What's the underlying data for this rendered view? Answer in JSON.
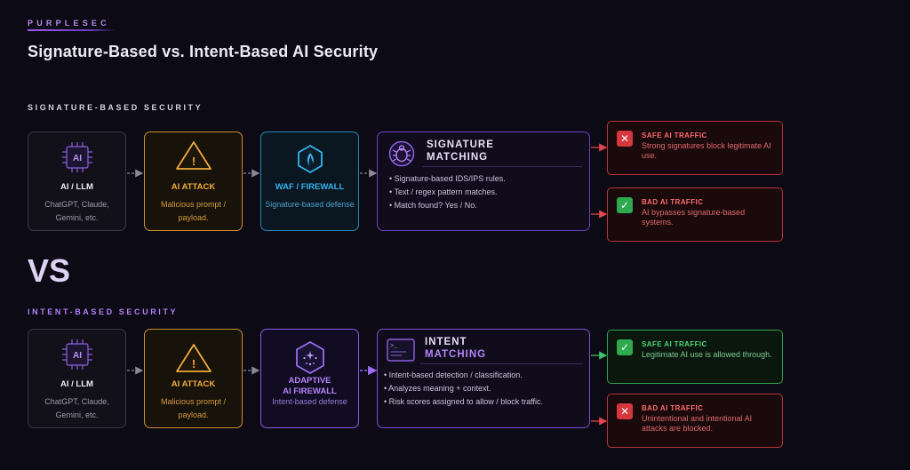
{
  "brand": "PURPLESEC",
  "title": "Signature-Based vs. Intent-Based AI Security",
  "vs_label": "VS",
  "signature_section": {
    "label": "SIGNATURE-BASED SECURITY",
    "ai_card": {
      "icon_text": "AI",
      "title": "AI / LLM",
      "subtitle": "ChatGPT, Claude, Gemini, etc.",
      "icon": "chip-icon"
    },
    "attack_card": {
      "icon_text": "!",
      "title": "AI ATTACK",
      "subtitle": "Malicious prompt / payload.",
      "icon": "warning-triangle-icon"
    },
    "defense_card": {
      "title": "WAF / FIREWALL",
      "subtitle": "Signature-based defense",
      "icon": "shield-hexagon-icon"
    },
    "matching": {
      "title_line1": "SIGNATURE",
      "title_line2": "MATCHING",
      "icon": "bug-icon",
      "bullets": [
        "• Signature-based IDS/IPS rules.",
        "• Text / regex pattern matches.",
        "• Match found? Yes / No."
      ]
    },
    "outcomes": [
      {
        "status": "fail",
        "title": "SAFE AI TRAFFIC",
        "desc": "Strong signatures block legitimate AI use."
      },
      {
        "status": "pass",
        "title": "BAD AI TRAFFIC",
        "desc": "AI bypasses signature-based systems."
      }
    ]
  },
  "intent_section": {
    "label": "INTENT-BASED SECURITY",
    "ai_card": {
      "icon_text": "AI",
      "title": "AI / LLM",
      "subtitle": "ChatGPT, Claude, Gemini, etc.",
      "icon": "chip-icon"
    },
    "attack_card": {
      "icon_text": "!",
      "title": "AI ATTACK",
      "subtitle": "Malicious prompt / payload.",
      "icon": "warning-triangle-icon"
    },
    "defense_card": {
      "title_line1": "ADAPTIVE",
      "title_line2": "AI FIREWALL",
      "subtitle": "Intent-based defense",
      "icon": "sparkle-hexagon-icon"
    },
    "matching": {
      "title_line1": "INTENT",
      "title_line2": "MATCHING",
      "icon": "terminal-icon",
      "bullets": [
        "• Intent-based detection / classification.",
        "• Analyzes meaning + context.",
        "• Risk scores assigned to allow / block traffic."
      ]
    },
    "outcomes": [
      {
        "status": "pass",
        "title": "SAFE AI TRAFFIC",
        "desc": "Legitimate AI use is allowed through."
      },
      {
        "status": "fail",
        "title": "BAD AI TRAFFIC",
        "desc": "Unintentional and intentional AI attacks are blocked."
      }
    ]
  },
  "colors": {
    "accent_purple": "#8a5ae0",
    "attack_orange": "#f1a93a",
    "waf_blue": "#36b3ee",
    "danger_red": "#d4373e",
    "success_green": "#2ea94f"
  }
}
